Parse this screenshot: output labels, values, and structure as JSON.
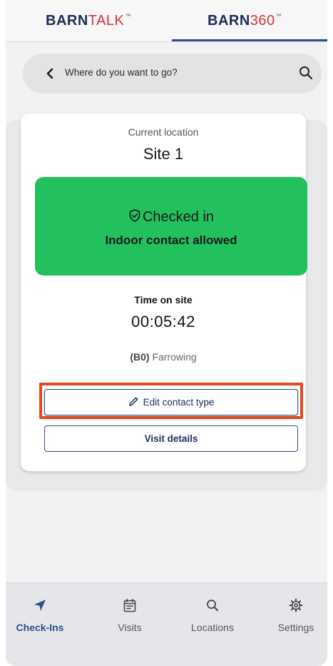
{
  "tabs": [
    {
      "label_main": "BARN",
      "label_accent": "TALK",
      "tm": "™"
    },
    {
      "label_main": "BARN",
      "label_accent": "360",
      "tm": "™"
    }
  ],
  "search": {
    "placeholder": "Where do you want to go?"
  },
  "card": {
    "current_location_label": "Current location",
    "site_name": "Site 1",
    "status": {
      "title": "Checked in",
      "subtitle": "Indoor contact allowed",
      "color": "#22c15e"
    },
    "time_label": "Time on site",
    "time_value": "00:05:42",
    "room_code": "(B0)",
    "room_name": "Farrowing",
    "edit_button": "Edit contact type",
    "visit_button": "Visit details"
  },
  "nav": {
    "items": [
      {
        "label": "Check-Ins",
        "icon": "location-arrow-icon",
        "active": true
      },
      {
        "label": "Visits",
        "icon": "calendar-icon",
        "active": false
      },
      {
        "label": "Locations",
        "icon": "search-icon",
        "active": false
      },
      {
        "label": "Settings",
        "icon": "gear-icon",
        "active": false
      }
    ]
  },
  "colors": {
    "accent": "#2b4f8f",
    "brand_red": "#d8343a",
    "highlight": "#e8461f"
  }
}
